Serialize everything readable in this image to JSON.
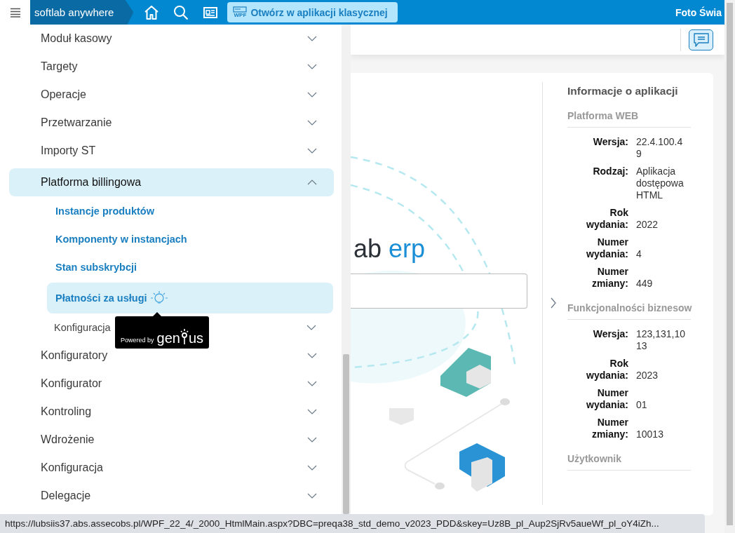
{
  "top_bar": {
    "app_name": "softlab anywhere",
    "open_button": {
      "badge": "WPF",
      "label": "Otwórz w aplikacji klasycznej"
    },
    "user": "Foto Świa"
  },
  "sidebar": {
    "items": [
      {
        "label": "Moduł kasowy",
        "expanded": false
      },
      {
        "label": "Targety",
        "expanded": false
      },
      {
        "label": "Operacje",
        "expanded": false
      },
      {
        "label": "Przetwarzanie",
        "expanded": false
      },
      {
        "label": "Importy ST",
        "expanded": false
      },
      {
        "label": "Platforma billingowa",
        "expanded": true,
        "children": [
          {
            "kind": "link",
            "label": "Instancje produktów",
            "selected": false,
            "hint": false
          },
          {
            "kind": "link",
            "label": "Komponenty w instancjach",
            "selected": false,
            "hint": false
          },
          {
            "kind": "link",
            "label": "Stan subskrybcji",
            "selected": false,
            "hint": false
          },
          {
            "kind": "link",
            "label": "Płatności za usługi",
            "selected": true,
            "hint": true
          },
          {
            "kind": "group",
            "label": "Konfiguracja",
            "selected": false,
            "expanded": false
          }
        ]
      },
      {
        "label": "Konfiguratory",
        "expanded": false
      },
      {
        "label": "Konfigurator",
        "expanded": false
      },
      {
        "label": "Kontroling",
        "expanded": false
      },
      {
        "label": "Wdrożenie",
        "expanded": false
      },
      {
        "label": "Konfiguracja",
        "expanded": false
      },
      {
        "label": "Delegacje",
        "expanded": false
      }
    ]
  },
  "tooltip": {
    "prefix": "Powered by",
    "brand_start": "gen",
    "brand_end": "us"
  },
  "main": {
    "logo": {
      "dark": "ab",
      "accent": "erp"
    },
    "info_panel": {
      "title": "Informacje o aplikacji",
      "sections": [
        {
          "title": "Platforma WEB",
          "rows": [
            {
              "label": "Wersja:",
              "value": [
                "22.4.100.4",
                "9"
              ]
            },
            {
              "label": "Rodzaj:",
              "value": [
                "Aplikacja",
                "dostępowa",
                "HTML"
              ]
            },
            {
              "label": "Rok wydania:",
              "value": [
                "2022"
              ]
            },
            {
              "label": "Numer wydania:",
              "value": [
                "4"
              ]
            },
            {
              "label": "Numer zmiany:",
              "value": [
                "449"
              ]
            }
          ]
        },
        {
          "title": "Funkcjonalności biznesow",
          "rows": [
            {
              "label": "Wersja:",
              "value": [
                "123,131,10",
                "13"
              ]
            },
            {
              "label": "Rok wydania:",
              "value": [
                "2023"
              ]
            },
            {
              "label": "Numer wydania:",
              "value": [
                "01"
              ]
            },
            {
              "label": "Numer zmiany:",
              "value": [
                "10013"
              ]
            }
          ]
        },
        {
          "title": "Użytkownik"
        }
      ]
    }
  },
  "status_bar": {
    "url": "https://lubsiis37.abs.assecobs.pl/WPF_22_4/_2000_HtmlMain.aspx?DBC=preqa38_std_demo_v2023_PDD&skey=Uz8B_pl_Aup2SjRv5aueWf_pl_oY4iZh..."
  }
}
